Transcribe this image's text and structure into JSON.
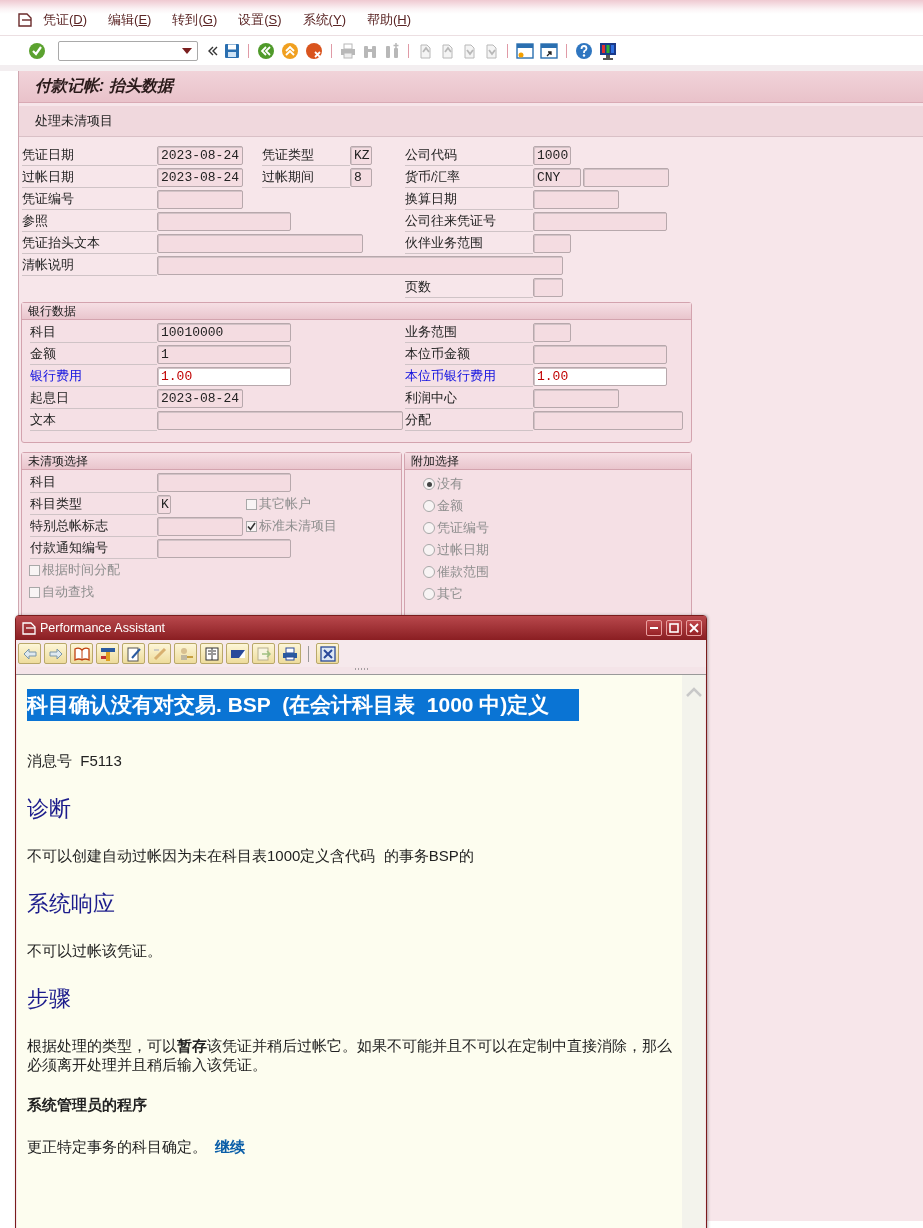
{
  "menu": [
    {
      "label": "凭证(D)"
    },
    {
      "label": "编辑(E)"
    },
    {
      "label": "转到(G)"
    },
    {
      "label": "设置(S)"
    },
    {
      "label": "系统(Y)"
    },
    {
      "label": "帮助(H)"
    }
  ],
  "screen": {
    "title": "付款记帐: 抬头数据",
    "app_toolbar": [
      {
        "label": "处理未清项目"
      }
    ]
  },
  "header": {
    "rows": [
      [
        {
          "label": "凭证日期",
          "value": "2023-08-24"
        },
        {
          "label": "凭证类型",
          "value": "KZ"
        },
        {
          "label": "公司代码",
          "value": "1000"
        }
      ],
      [
        {
          "label": "过帐日期",
          "value": "2023-08-24"
        },
        {
          "label": "过帐期间",
          "value": "8"
        },
        {
          "label": "货币/汇率",
          "value": "CNY"
        }
      ],
      [
        {
          "label": "凭证编号"
        },
        null,
        {
          "label": "换算日期"
        }
      ],
      [
        {
          "label": "参照"
        },
        null,
        {
          "label": "公司往来凭证号"
        }
      ],
      [
        {
          "label": "凭证抬头文本"
        },
        null,
        {
          "label": "伙伴业务范围"
        }
      ],
      [
        {
          "label": "清帐说明"
        },
        null,
        null
      ],
      [
        null,
        null,
        {
          "label": "页数"
        }
      ]
    ]
  },
  "bank": {
    "title": "银行数据",
    "fields": [
      {
        "label": "科目",
        "value": "10010000",
        "editable": false
      },
      {
        "label": "业务范围",
        "editable": false
      },
      {
        "label": "金额",
        "value": "1",
        "editable": false
      },
      {
        "label": "本位币金额",
        "editable": false
      },
      {
        "label": "银行费用",
        "value": "1.00",
        "editable": true
      },
      {
        "label": "本位币银行费用",
        "value": "1.00",
        "editable": true
      },
      {
        "label": "起息日",
        "value": "2023-08-24",
        "editable": false
      },
      {
        "label": "利润中心",
        "editable": false
      },
      {
        "label": "文本",
        "editable": false
      },
      {
        "label": "分配",
        "editable": false
      }
    ]
  },
  "open_items": {
    "title": "未清项选择",
    "rows": [
      {
        "kind": "field",
        "label": "科目"
      },
      {
        "kind": "field",
        "label": "科目类型",
        "value": "K",
        "checkbox": {
          "label": "其它帐户",
          "checked": false,
          "disabled": true
        }
      },
      {
        "kind": "field",
        "label": "特别总帐标志",
        "checkbox": {
          "label": "标准未清项目",
          "checked": true,
          "disabled": true
        }
      },
      {
        "kind": "field",
        "label": "付款通知编号"
      },
      {
        "kind": "checkbox",
        "label": "根据时间分配",
        "checked": false,
        "disabled": true
      },
      {
        "kind": "checkbox",
        "label": "自动查找",
        "checked": false,
        "disabled": true
      }
    ]
  },
  "additional": {
    "title": "附加选择",
    "options": [
      {
        "label": "没有",
        "selected": true,
        "disabled": true
      },
      {
        "label": "金额",
        "selected": false,
        "disabled": true
      },
      {
        "label": "凭证编号",
        "selected": false,
        "disabled": true
      },
      {
        "label": "过帐日期",
        "selected": false,
        "disabled": true
      },
      {
        "label": "催款范围",
        "selected": false,
        "disabled": true
      },
      {
        "label": "其它",
        "selected": false,
        "disabled": true
      }
    ]
  },
  "popup": {
    "title": "Performance Assistant",
    "heading": {
      "text": "科目确认没有对交易. BSP  (在会计科目表  1000 中)定义",
      "selected": true
    },
    "sections": [
      {
        "kind": "paragraph",
        "text": "消息号  F5113"
      },
      {
        "kind": "heading",
        "text": "诊断"
      },
      {
        "kind": "paragraph",
        "text": "不可以创建自动过帐因为未在科目表1000定义含代码  的事务BSP的"
      },
      {
        "kind": "heading",
        "text": "系统响应"
      },
      {
        "kind": "paragraph",
        "text": "不可以过帐该凭证。"
      },
      {
        "kind": "heading",
        "text": "步骤"
      },
      {
        "kind": "paragraph",
        "text": "根据处理的类型，可以**暂存**该凭证并稍后过帐它。如果不可能并且不可以在定制中直接消除，那么必须离开处理并且稍后输入该凭证。"
      },
      {
        "kind": "subheading",
        "text": "系统管理员的程序"
      },
      {
        "kind": "paragraph",
        "text": "更正特定事务的科目确定。",
        "link": "继续"
      }
    ]
  }
}
